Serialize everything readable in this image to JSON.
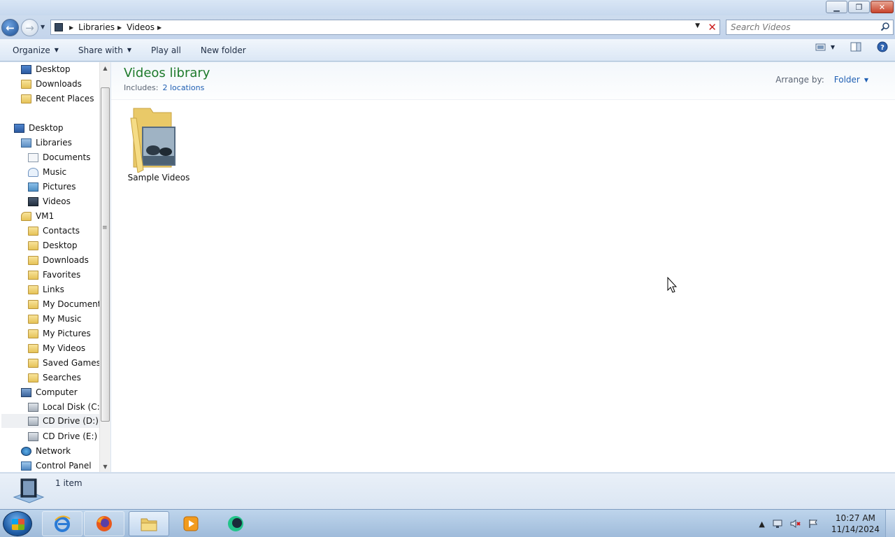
{
  "window": {
    "controls": {
      "minimize_icon": "minimize-icon",
      "maximize_icon": "restore-icon",
      "close_icon": "close-icon"
    }
  },
  "address_bar": {
    "breadcrumbs": [
      "Libraries",
      "Videos"
    ],
    "search_placeholder": "Search Videos"
  },
  "toolbar": {
    "organize": "Organize",
    "share_with": "Share with",
    "play_all": "Play all",
    "new_folder": "New folder"
  },
  "nav_pane": {
    "items": [
      {
        "label": "Desktop",
        "icon": "desktop-icon"
      },
      {
        "label": "Downloads",
        "icon": "downloads-folder-icon"
      },
      {
        "label": "Recent Places",
        "icon": "recent-places-icon"
      },
      {
        "label": "Desktop",
        "icon": "desktop-icon"
      },
      {
        "label": "Libraries",
        "icon": "libraries-icon"
      },
      {
        "label": "Documents",
        "icon": "documents-icon"
      },
      {
        "label": "Music",
        "icon": "music-icon"
      },
      {
        "label": "Pictures",
        "icon": "pictures-icon"
      },
      {
        "label": "Videos",
        "icon": "videos-icon"
      },
      {
        "label": "VM1",
        "icon": "user-folder-icon"
      },
      {
        "label": "Contacts",
        "icon": "folder-icon"
      },
      {
        "label": "Desktop",
        "icon": "folder-icon"
      },
      {
        "label": "Downloads",
        "icon": "folder-icon"
      },
      {
        "label": "Favorites",
        "icon": "favorites-icon"
      },
      {
        "label": "Links",
        "icon": "folder-icon"
      },
      {
        "label": "My Documents",
        "icon": "folder-icon"
      },
      {
        "label": "My Music",
        "icon": "folder-icon"
      },
      {
        "label": "My Pictures",
        "icon": "folder-icon"
      },
      {
        "label": "My Videos",
        "icon": "folder-icon"
      },
      {
        "label": "Saved Games",
        "icon": "folder-icon"
      },
      {
        "label": "Searches",
        "icon": "folder-icon"
      },
      {
        "label": "Computer",
        "icon": "computer-icon"
      },
      {
        "label": "Local Disk (C:)",
        "icon": "disk-icon"
      },
      {
        "label": "CD Drive (D:)",
        "icon": "cd-drive-icon"
      },
      {
        "label": "CD Drive (E:)",
        "icon": "cd-drive-icon"
      },
      {
        "label": "Network",
        "icon": "network-icon"
      },
      {
        "label": "Control Panel",
        "icon": "control-panel-icon"
      }
    ]
  },
  "library": {
    "title": "Videos library",
    "includes_label": "Includes:",
    "includes_link": "2 locations",
    "arrange_label": "Arrange by:",
    "arrange_value": "Folder"
  },
  "items": [
    {
      "label": "Sample Videos",
      "icon": "video-folder-icon"
    }
  ],
  "details": {
    "count": "1 item"
  },
  "taskbar": {
    "apps": [
      {
        "name": "Internet Explorer",
        "icon": "ie-icon"
      },
      {
        "name": "Firefox",
        "icon": "firefox-icon"
      },
      {
        "name": "Windows Explorer",
        "icon": "explorer-icon"
      },
      {
        "name": "Windows Media Player",
        "icon": "media-player-icon"
      },
      {
        "name": "App",
        "icon": "app-icon"
      }
    ],
    "clock_time": "10:27 AM",
    "clock_date": "11/14/2024"
  }
}
